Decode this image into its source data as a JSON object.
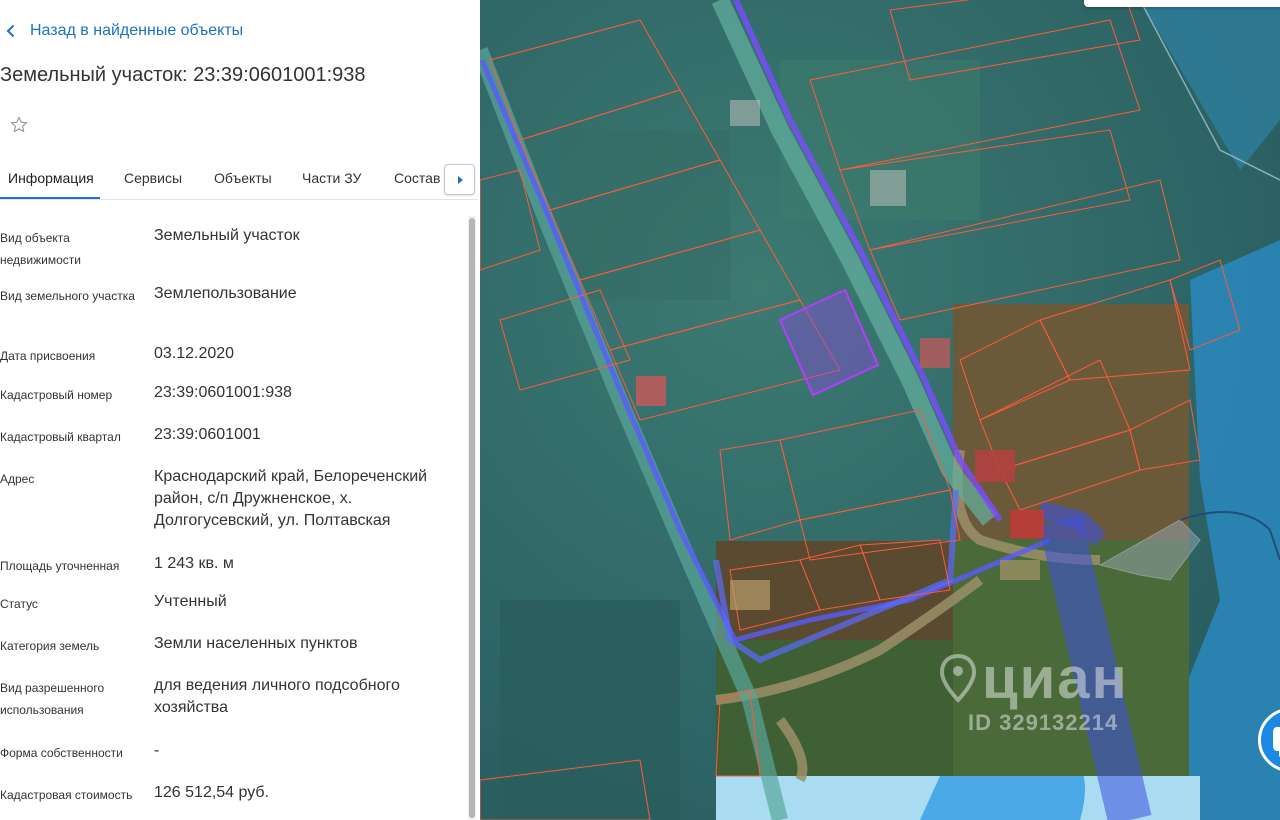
{
  "header": {
    "back_label": "Назад в найденные объекты",
    "title": "Земельный участок: 23:39:0601001:938"
  },
  "tabs": [
    {
      "label": "Информация",
      "active": true
    },
    {
      "label": "Сервисы"
    },
    {
      "label": "Объекты"
    },
    {
      "label": "Части ЗУ"
    },
    {
      "label": "Состав"
    }
  ],
  "properties": [
    {
      "label": "Вид объекта недвижимости",
      "value": "Земельный участок"
    },
    {
      "label": "Вид земельного участка",
      "value": "Землепользование"
    },
    {
      "label": "Дата присвоения",
      "value": "03.12.2020"
    },
    {
      "label": "Кадастровый номер",
      "value": "23:39:0601001:938"
    },
    {
      "label": "Кадастровый квартал",
      "value": "23:39:0601001"
    },
    {
      "label": "Адрес",
      "value": "Краснодарский край, Белореченский район, с/п Дружненское, х. Долгогусевский, ул. Полтавская"
    },
    {
      "label": "Площадь уточненная",
      "value": "1 243 кв. м"
    },
    {
      "label": "Статус",
      "value": "Учтенный"
    },
    {
      "label": "Категория земель",
      "value": "Земли населенных пунктов"
    },
    {
      "label": "Вид разрешенного использования",
      "value": "для ведения личного подсобного хозяйства"
    },
    {
      "label": "Форма собственности",
      "value": "-"
    },
    {
      "label": "Кадастровая стоимость",
      "value": "126 512,54 руб."
    }
  ],
  "map": {
    "watermark_brand": "циан",
    "watermark_id": "ID 329132214"
  },
  "colors": {
    "accent": "#1a73c7",
    "text": "#333333",
    "parcel_border": "#ff5a3c",
    "selected_parcel": "#b43cff",
    "road_highlight": "#5a5aff"
  },
  "icons": {
    "back": "chevron-left-icon",
    "favorite": "star-outline-icon",
    "tabs_next": "triangle-right-icon",
    "chat": "chat-bubble-icon",
    "watermark": "map-pin-icon"
  }
}
